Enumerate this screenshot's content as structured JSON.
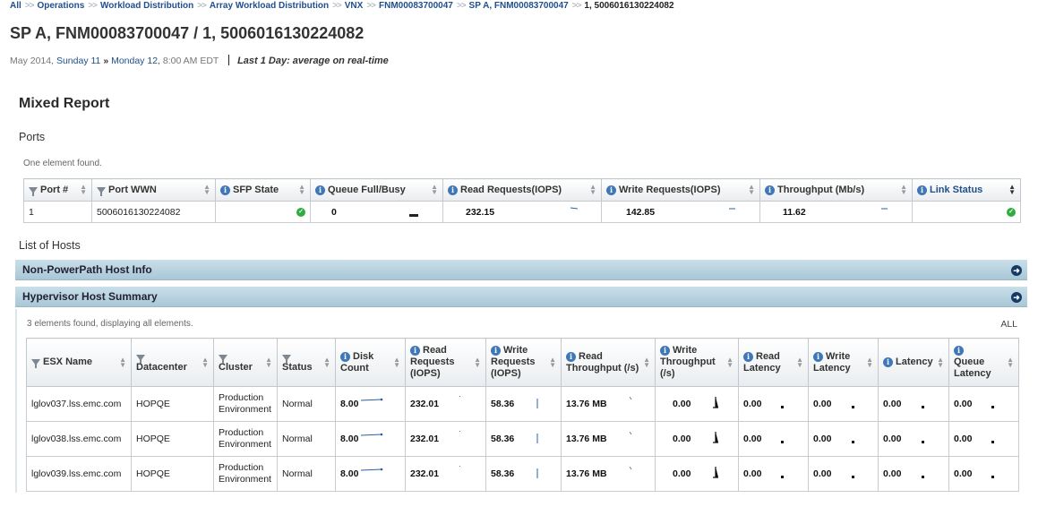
{
  "breadcrumb": [
    "All",
    "Operations",
    "Workload Distribution",
    "Array Workload Distribution",
    "VNX",
    "FNM00083700047",
    "SP A, FNM00083700047",
    "1, 5006016130224082"
  ],
  "breadcrumb_sep": ">>",
  "title": "SP A, FNM00083700047 / 1, 5006016130224082",
  "time": {
    "month": "May 2014,",
    "start": "Sunday 11",
    "sep": "»",
    "end": "Monday 12,",
    "clock": "8:00 AM EDT",
    "period": "Last 1 Day: average on real-time"
  },
  "report_title": "Mixed Report",
  "ports": {
    "label": "Ports",
    "found": "One element found.",
    "columns": [
      "Port #",
      "Port WWN",
      "SFP State",
      "Queue Full/Busy",
      "Read Requests(IOPS)",
      "Write Requests(IOPS)",
      "Throughput (Mb/s)",
      "Link Status"
    ],
    "rows": [
      {
        "port": "1",
        "wwn": "5006016130224082",
        "queue": "0",
        "read": "232.15",
        "write": "142.85",
        "throughput": "11.62"
      }
    ]
  },
  "hosts": {
    "label": "List of Hosts",
    "sections": [
      "Non-PowerPath Host Info",
      "Hypervisor Host Summary"
    ],
    "found": "3 elements found, displaying all elements.",
    "all_label": "ALL",
    "columns": [
      "ESX Name",
      "Datacenter",
      "Cluster",
      "Status",
      "Disk Count",
      "Read Requests (IOPS)",
      "Write Requests (IOPS)",
      "Read Throughput (/s)",
      "Write Throughput (/s)",
      "Read Latency",
      "Write Latency",
      "Latency",
      "Queue Latency"
    ],
    "rows": [
      {
        "name": "lglov037.lss.emc.com",
        "datacenter": "HOPQE",
        "cluster1": "Production",
        "cluster2": "Environment",
        "status": "Normal",
        "disk": "8.00",
        "read": "232.01",
        "write": "58.36",
        "rthru": "13.76 MB",
        "wthru": "0.00",
        "rlat": "0.00",
        "wlat": "0.00",
        "lat": "0.00",
        "qlat": "0.00"
      },
      {
        "name": "lglov038.lss.emc.com",
        "datacenter": "HOPQE",
        "cluster1": "Production",
        "cluster2": "Environment",
        "status": "Normal",
        "disk": "8.00",
        "read": "232.01",
        "write": "58.36",
        "rthru": "13.76 MB",
        "wthru": "0.00",
        "rlat": "0.00",
        "wlat": "0.00",
        "lat": "0.00",
        "qlat": "0.00"
      },
      {
        "name": "lglov039.lss.emc.com",
        "datacenter": "HOPQE",
        "cluster1": "Production",
        "cluster2": "Environment",
        "status": "Normal",
        "disk": "8.00",
        "read": "232.01",
        "write": "58.36",
        "rthru": "13.76 MB",
        "wthru": "0.00",
        "rlat": "0.00",
        "wlat": "0.00",
        "lat": "0.00",
        "qlat": "0.00"
      }
    ]
  },
  "colors": {
    "link": "#1f4f8c",
    "ok": "#2eac3f",
    "accordion": "#b5d0dd",
    "info": "#3f77b8"
  }
}
